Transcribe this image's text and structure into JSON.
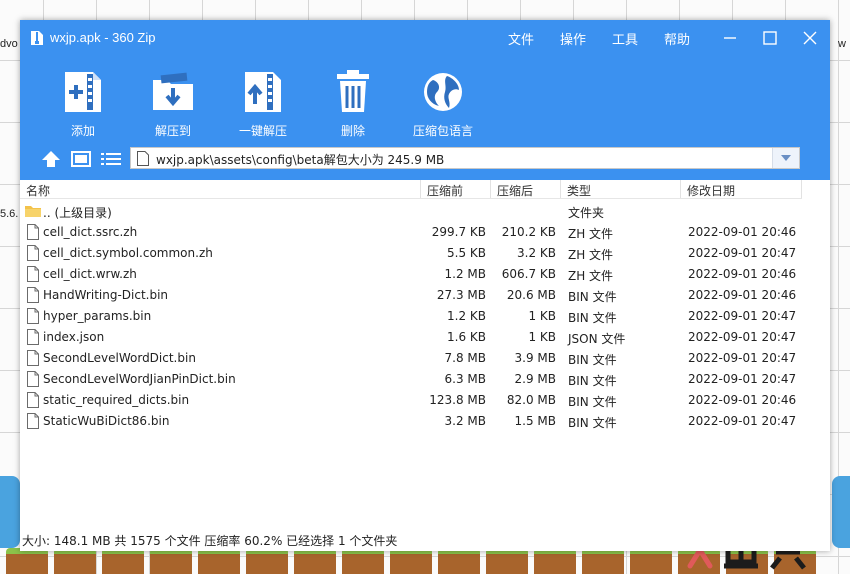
{
  "window": {
    "title": "wxjp.apk - 360 Zip",
    "menu": [
      "文件",
      "操作",
      "工具",
      "帮助"
    ]
  },
  "toolbar": {
    "add": "添加",
    "extract_to": "解压到",
    "one_click_extract": "一键解压",
    "delete": "删除",
    "archive_language": "压缩包语言"
  },
  "path": {
    "value": "wxjp.apk\\assets\\config\\beta解包大小为 245.9 MB"
  },
  "columns": {
    "name": "名称",
    "compressed_before": "压缩前",
    "compressed_after": "压缩后",
    "type": "类型",
    "modified": "修改日期"
  },
  "parent_row": {
    "name": ".. (上级目录)",
    "type": "文件夹"
  },
  "files": [
    {
      "name": "cell_dict.ssrc.zh",
      "before": "299.7 KB",
      "after": "210.2 KB",
      "type": "ZH 文件",
      "date": "2022-09-01 20:46"
    },
    {
      "name": "cell_dict.symbol.common.zh",
      "before": "5.5 KB",
      "after": "3.2 KB",
      "type": "ZH 文件",
      "date": "2022-09-01 20:47"
    },
    {
      "name": "cell_dict.wrw.zh",
      "before": "1.2 MB",
      "after": "606.7 KB",
      "type": "ZH 文件",
      "date": "2022-09-01 20:46"
    },
    {
      "name": "HandWriting-Dict.bin",
      "before": "27.3 MB",
      "after": "20.6 MB",
      "type": "BIN 文件",
      "date": "2022-09-01 20:46"
    },
    {
      "name": "hyper_params.bin",
      "before": "1.2 KB",
      "after": "1 KB",
      "type": "BIN 文件",
      "date": "2022-09-01 20:47"
    },
    {
      "name": "index.json",
      "before": "1.6 KB",
      "after": "1 KB",
      "type": "JSON 文件",
      "date": "2022-09-01 20:47"
    },
    {
      "name": "SecondLevelWordDict.bin",
      "before": "7.8 MB",
      "after": "3.9 MB",
      "type": "BIN 文件",
      "date": "2022-09-01 20:47"
    },
    {
      "name": "SecondLevelWordJianPinDict.bin",
      "before": "6.3 MB",
      "after": "2.9 MB",
      "type": "BIN 文件",
      "date": "2022-09-01 20:47"
    },
    {
      "name": "static_required_dicts.bin",
      "before": "123.8 MB",
      "after": "82.0 MB",
      "type": "BIN 文件",
      "date": "2022-09-01 20:46"
    },
    {
      "name": "StaticWuBiDict86.bin",
      "before": "3.2 MB",
      "after": "1.5 MB",
      "type": "BIN 文件",
      "date": "2022-09-01 20:47"
    }
  ],
  "status": {
    "text": "大小: 148.1 MB 共 1575 个文件 压缩率 60.2% 已经选择 1 个文件夹"
  },
  "background": {
    "left_fragment_top": "dvo",
    "left_fragment_mid": "5.6.",
    "right_fragment_top": "w"
  },
  "colors": {
    "header_blue": "#3b91f0",
    "folder_yellow": "#f3c24a",
    "watermark_red": "#e05a5a"
  }
}
